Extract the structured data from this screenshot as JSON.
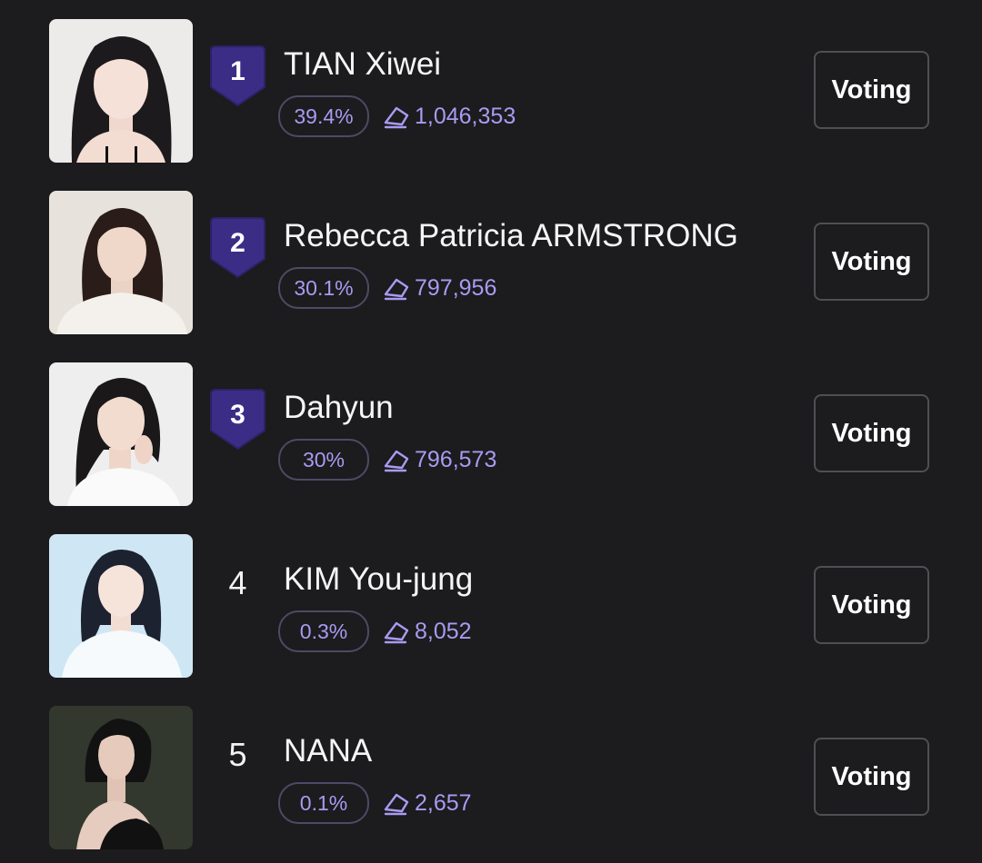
{
  "colors": {
    "background": "#1c1b1d",
    "accent": "#a89bf2",
    "badge": "#3b2d86"
  },
  "vote_icon": "diamond-outline-icon",
  "candidates": [
    {
      "rank": "1",
      "name": "TIAN Xiwei",
      "percent": "39.4%",
      "votes": "1,046,353",
      "button_label": "Voting",
      "badge": true
    },
    {
      "rank": "2",
      "name": "Rebecca Patricia ARMSTRONG",
      "percent": "30.1%",
      "votes": "797,956",
      "button_label": "Voting",
      "badge": true
    },
    {
      "rank": "3",
      "name": "Dahyun",
      "percent": "30%",
      "votes": "796,573",
      "button_label": "Voting",
      "badge": true
    },
    {
      "rank": "4",
      "name": "KIM You-jung",
      "percent": "0.3%",
      "votes": "8,052",
      "button_label": "Voting",
      "badge": false
    },
    {
      "rank": "5",
      "name": "NANA",
      "percent": "0.1%",
      "votes": "2,657",
      "button_label": "Voting",
      "badge": false
    }
  ]
}
